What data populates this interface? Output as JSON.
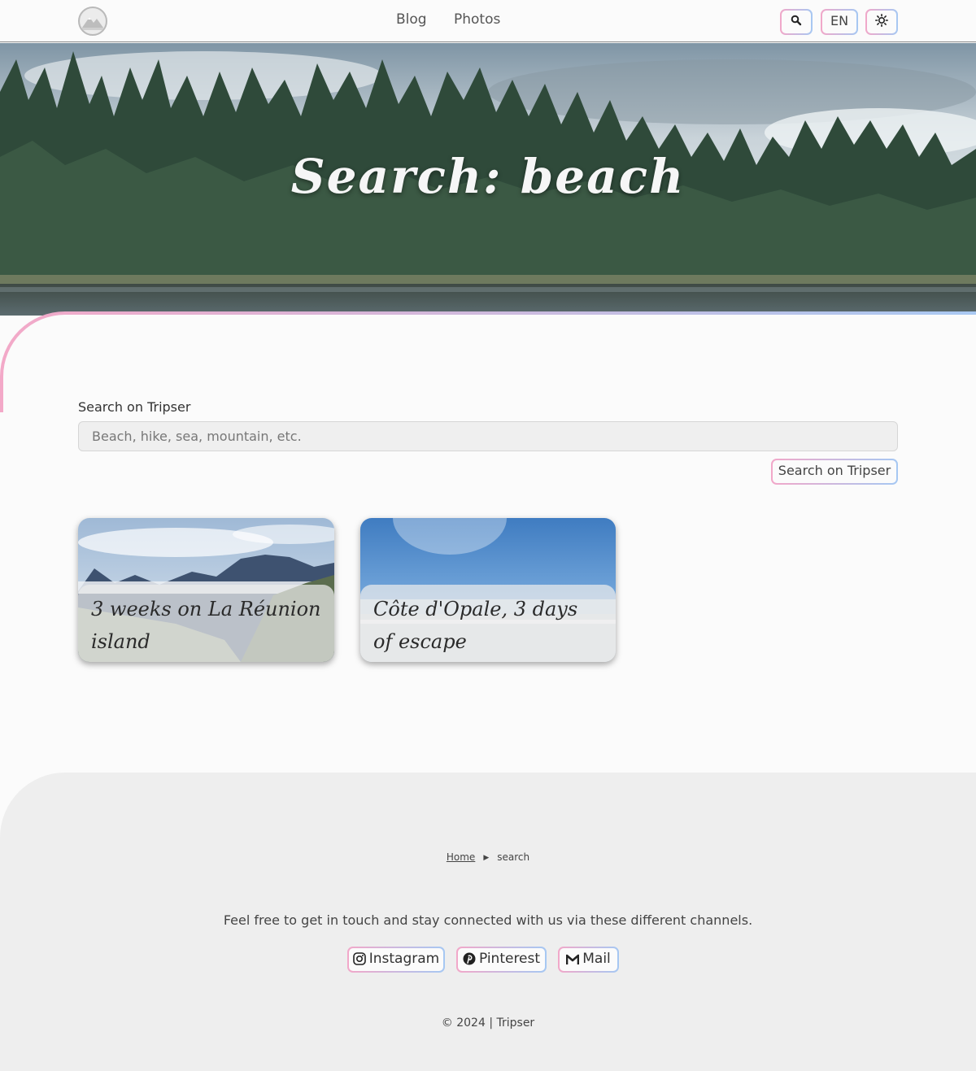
{
  "header": {
    "nav": [
      "Blog",
      "Photos"
    ],
    "language": "EN",
    "search_icon": "search-icon",
    "theme_icon": "sun-icon"
  },
  "hero": {
    "title": "Search: beach"
  },
  "search": {
    "label": "Search on Tripser",
    "placeholder": "Beach, hike, sea, mountain, etc.",
    "button": "Search on Tripser"
  },
  "results": [
    {
      "title": "3 weeks on La Réunion island"
    },
    {
      "title": "Côte d'Opale, 3 days of escape"
    }
  ],
  "footer": {
    "breadcrumb": {
      "home": "Home",
      "current": "search"
    },
    "text": "Feel free to get in touch and stay connected with us via these different channels.",
    "social": [
      {
        "label": "Instagram",
        "icon": "instagram-icon"
      },
      {
        "label": "Pinterest",
        "icon": "pinterest-icon"
      },
      {
        "label": "Mail",
        "icon": "gmail-icon"
      }
    ],
    "copyright": "© 2024 | Tripser"
  },
  "colors": {
    "gradient_start": "#f2a8c9",
    "gradient_end": "#a6c8f3",
    "background": "#fbfbfb",
    "footer_bg": "#eeeeee"
  }
}
